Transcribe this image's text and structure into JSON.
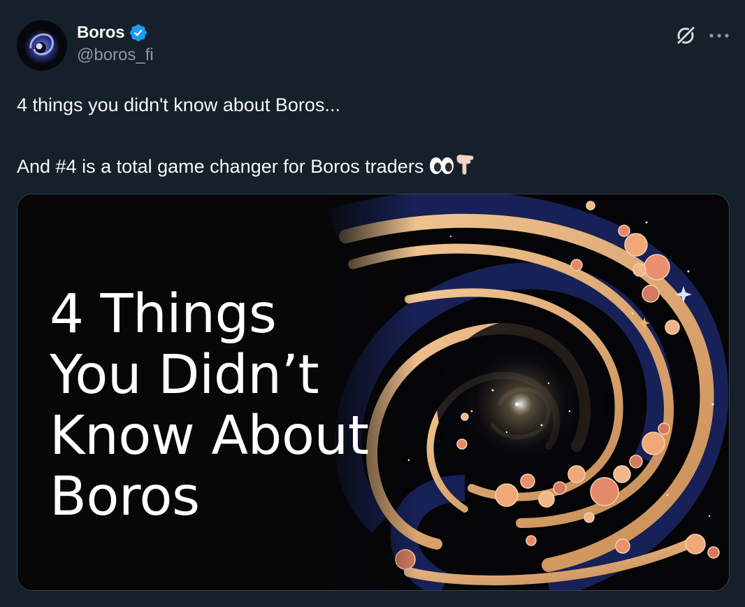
{
  "author": {
    "display_name": "Boros",
    "handle": "@boros_fi",
    "verified": true,
    "avatar_icon": "boros-logo-icon"
  },
  "actions": {
    "grok_icon": "grok-icon",
    "more_icon": "more-icon"
  },
  "tweet": {
    "line1": "4 things you didn't know about Boros...",
    "line2": "And #4 is a total game changer for Boros traders",
    "emojis": [
      "eyes-emoji",
      "pointing-down-emoji"
    ]
  },
  "media": {
    "headline_lines": [
      "4 Things",
      "You Didn’t",
      "Know About",
      "Boros"
    ],
    "description_icon": "galaxy-swirl-image"
  },
  "colors": {
    "background": "#15202b",
    "text": "#f7f9f9",
    "muted": "#8b98a5",
    "verified": "#1d9bf0",
    "border": "#38444d"
  }
}
